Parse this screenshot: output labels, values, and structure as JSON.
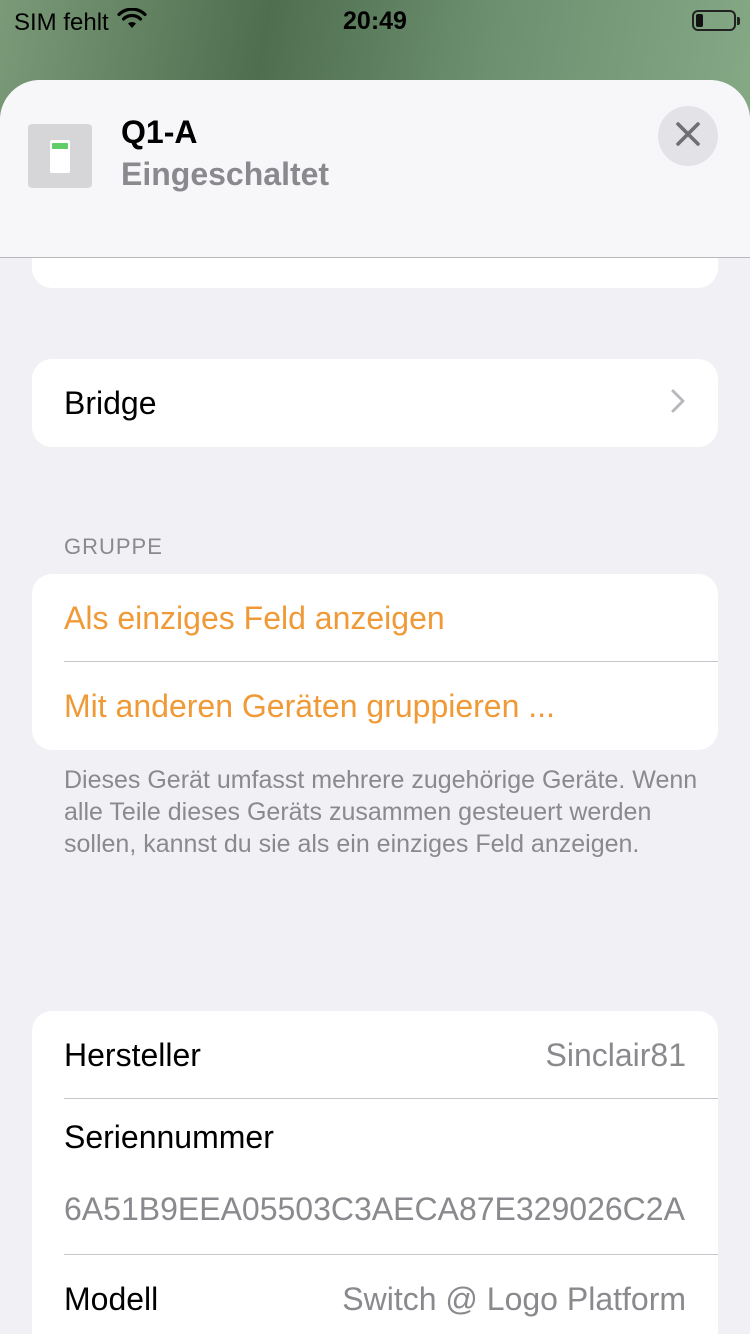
{
  "status_bar": {
    "carrier": "SIM fehlt",
    "time": "20:49"
  },
  "header": {
    "title": "Q1-A",
    "status": "Eingeschaltet",
    "icon": "switch-tile-icon",
    "close_icon": "close-icon"
  },
  "bridge_row": {
    "label": "Bridge"
  },
  "group_section": {
    "header": "GRUPPE",
    "items": [
      {
        "label": "Als einziges Feld anzeigen"
      },
      {
        "label": "Mit anderen Geräten gruppieren ..."
      }
    ],
    "footnote": "Dieses Gerät umfasst mehrere zugehörige Geräte. Wenn alle Teile dieses Geräts zusammen gesteuert werden sollen, kannst du sie als ein einziges Feld anzeigen."
  },
  "info": {
    "manufacturer_label": "Hersteller",
    "manufacturer_value": "Sinclair81",
    "serial_label": "Seriennummer",
    "serial_value": "6A51B9EEA05503C3AECA87E329026C2A",
    "model_label": "Modell",
    "model_value": "Switch @ Logo Platform"
  },
  "colors": {
    "accent": "#f09a37",
    "secondary_text": "#8a8a8e",
    "background": "#f1f1f5",
    "switch_on": "#5fce68"
  }
}
